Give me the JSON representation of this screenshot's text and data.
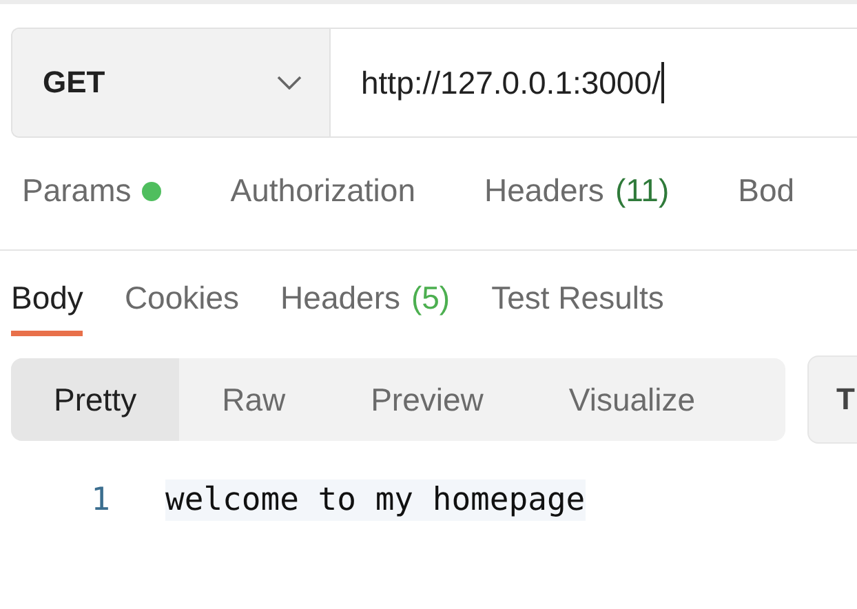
{
  "request": {
    "method": "GET",
    "url": "http://127.0.0.1:3000/"
  },
  "request_tabs": [
    {
      "label": "Params",
      "dot": true,
      "selected": false
    },
    {
      "label": "Authorization",
      "dot": false,
      "selected": false
    },
    {
      "label": "Headers",
      "count": "(11)",
      "dot": false,
      "selected": false
    },
    {
      "label": "Bod",
      "dot": false,
      "selected": false
    }
  ],
  "response_tabs": [
    {
      "label": "Body",
      "selected": true
    },
    {
      "label": "Cookies",
      "selected": false
    },
    {
      "label": "Headers",
      "count": "(5)",
      "selected": false
    },
    {
      "label": "Test Results",
      "selected": false
    }
  ],
  "view_modes": [
    {
      "label": "Pretty",
      "selected": true
    },
    {
      "label": "Raw",
      "selected": false
    },
    {
      "label": "Preview",
      "selected": false
    },
    {
      "label": "Visualize",
      "selected": false
    }
  ],
  "format_button": "T",
  "body_lines": [
    {
      "number": "1",
      "text": "welcome to my homepage"
    }
  ]
}
